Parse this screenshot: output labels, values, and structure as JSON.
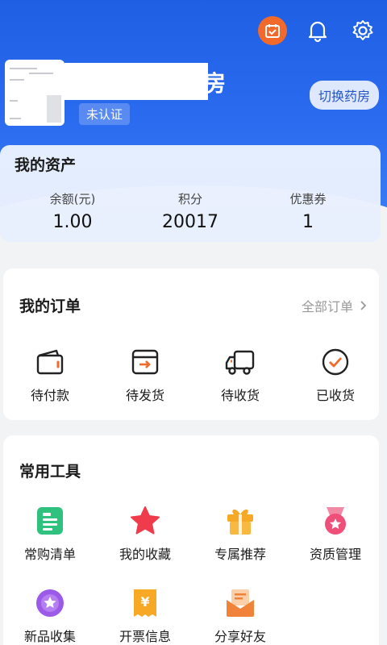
{
  "header": {
    "store_name_tail": "房",
    "verify_status": "未认证",
    "switch_label": "切换药房",
    "icons": [
      "calendar-check-icon",
      "bell-icon",
      "gear-icon"
    ]
  },
  "assets": {
    "title": "我的资产",
    "items": [
      {
        "label": "余额(元)",
        "value": "1.00"
      },
      {
        "label": "积分",
        "value": "20017"
      },
      {
        "label": "优惠券",
        "value": "1"
      }
    ]
  },
  "orders": {
    "title": "我的订单",
    "all_label": "全部订单",
    "items": [
      {
        "label": "待付款",
        "icon": "wallet-icon"
      },
      {
        "label": "待发货",
        "icon": "box-send-icon"
      },
      {
        "label": "待收货",
        "icon": "truck-icon"
      },
      {
        "label": "已收货",
        "icon": "check-circle-icon"
      }
    ]
  },
  "tools": {
    "title": "常用工具",
    "items": [
      {
        "label": "常购清单",
        "icon": "list-icon"
      },
      {
        "label": "我的收藏",
        "icon": "star-icon"
      },
      {
        "label": "专属推荐",
        "icon": "gift-icon"
      },
      {
        "label": "资质管理",
        "icon": "medal-icon"
      },
      {
        "label": "新品收集",
        "icon": "new-star-icon"
      },
      {
        "label": "开票信息",
        "icon": "invoice-icon"
      },
      {
        "label": "分享好友",
        "icon": "share-envelope-icon"
      }
    ]
  },
  "colors": {
    "header_blue": "#2a6bf0",
    "accent_orange": "#f26a2b",
    "tool_green": "#2ec27e",
    "tool_red": "#ef3b4b",
    "tool_yellow": "#f7a825",
    "tool_pink": "#ef4f79",
    "tool_purple": "#9b5be8"
  }
}
